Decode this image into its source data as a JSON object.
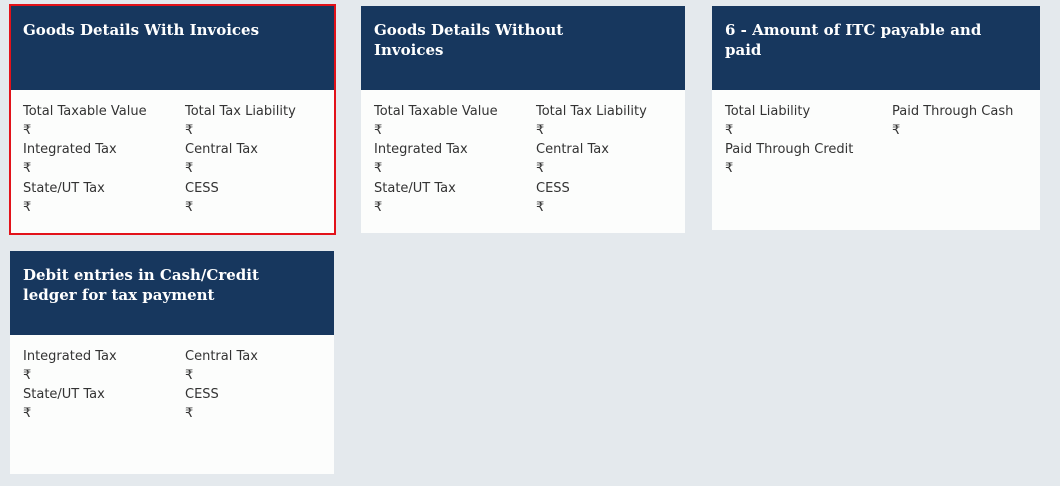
{
  "currency_symbol": "₹",
  "tiles": [
    {
      "title": "Goods Details With Invoices",
      "fields": [
        {
          "label": "Total Taxable Value",
          "value": "₹"
        },
        {
          "label": "Total Tax Liability",
          "value": "₹"
        },
        {
          "label": "Integrated Tax",
          "value": "₹"
        },
        {
          "label": "Central Tax",
          "value": "₹"
        },
        {
          "label": "State/UT Tax",
          "value": "₹"
        },
        {
          "label": "CESS",
          "value": "₹"
        }
      ]
    },
    {
      "title": "Goods Details Without Invoices",
      "fields": [
        {
          "label": "Total Taxable Value",
          "value": "₹"
        },
        {
          "label": "Total Tax Liability",
          "value": "₹"
        },
        {
          "label": "Integrated Tax",
          "value": "₹"
        },
        {
          "label": "Central Tax",
          "value": "₹"
        },
        {
          "label": "State/UT Tax",
          "value": "₹"
        },
        {
          "label": "CESS",
          "value": "₹"
        }
      ]
    },
    {
      "title": "6 - Amount of ITC payable and paid",
      "fields": [
        {
          "label": "Total Liability",
          "value": "₹"
        },
        {
          "label": "Paid Through Cash",
          "value": "₹"
        },
        {
          "label": "Paid Through Credit",
          "value": "₹"
        }
      ]
    },
    {
      "title": "Debit entries in Cash/Credit ledger for tax payment",
      "fields": [
        {
          "label": "Integrated Tax",
          "value": "₹"
        },
        {
          "label": "Central Tax",
          "value": "₹"
        },
        {
          "label": "State/UT Tax",
          "value": "₹"
        },
        {
          "label": "CESS",
          "value": "₹"
        }
      ]
    }
  ]
}
